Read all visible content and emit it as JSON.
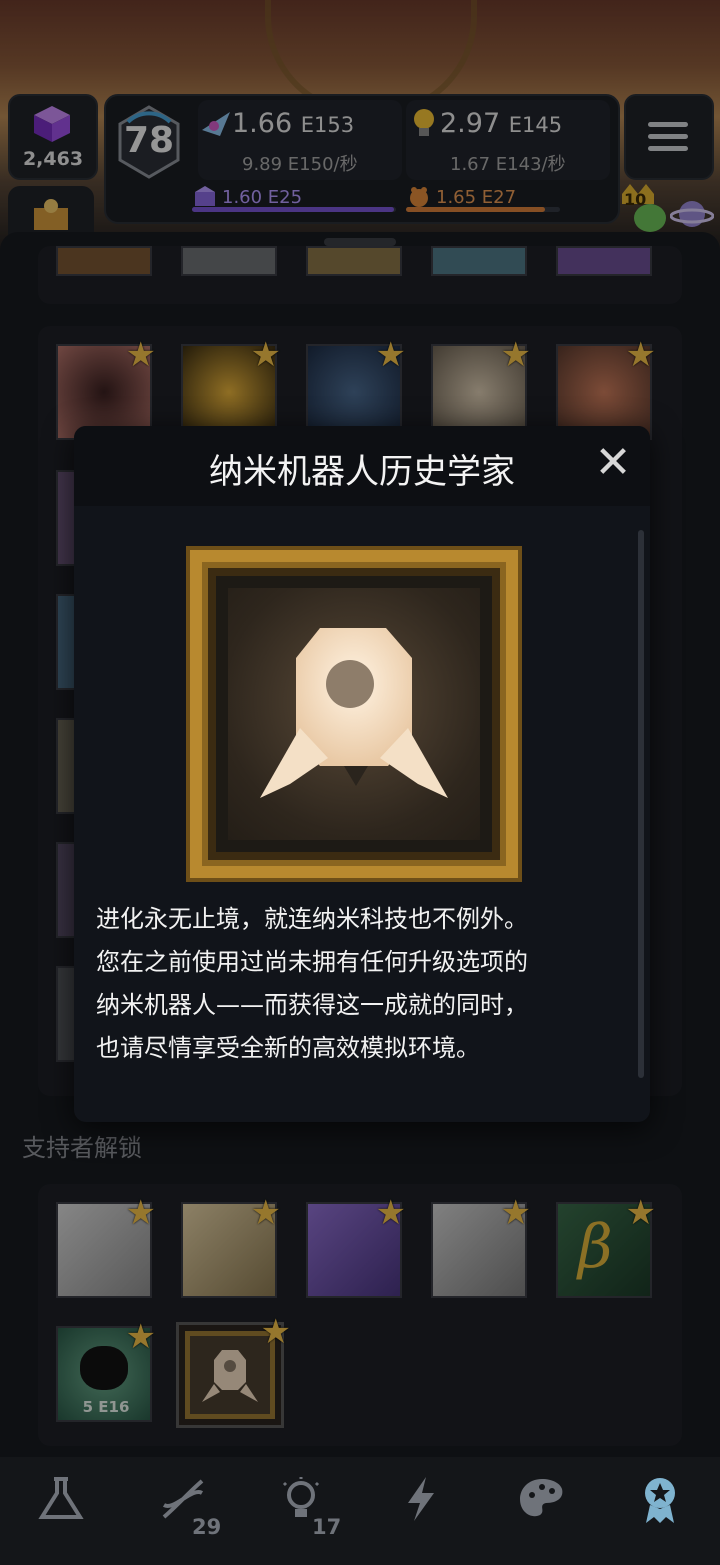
{
  "hud": {
    "cubes": "2,463",
    "level": "78",
    "resource1": {
      "mantissa": "1.66",
      "exp": "E153",
      "rate": "9.89 E150/秒",
      "bar_value": "1.60 E25",
      "bar_progress": 0.99
    },
    "resource2": {
      "mantissa": "2.97",
      "exp": "E145",
      "rate": "1.67 E143/秒",
      "bar_value": "1.65 E27",
      "bar_progress": 0.9
    },
    "badge_count": "10"
  },
  "dialog": {
    "title": "纳米机器人历史学家",
    "close": "✕",
    "description_lines": [
      "进化永无止境，就连纳米科技也不例外。",
      "您在之前使用过尚未拥有任何升级选项的",
      "纳米机器人——而获得这一成就的同时，",
      "也请尽情享受全新的高效模拟环境。"
    ]
  },
  "section": {
    "title": "支持者解锁"
  },
  "support_tiles": [
    {
      "name": "toast-1",
      "label": ""
    },
    {
      "name": "toast-2",
      "label": ""
    },
    {
      "name": "toast-3",
      "label": ""
    },
    {
      "name": "hand",
      "label": ""
    },
    {
      "name": "beta",
      "label": "β"
    },
    {
      "name": "blob",
      "label": "5 E16"
    },
    {
      "name": "nanobot-portrait",
      "label": ""
    }
  ],
  "nav": {
    "items": [
      {
        "name": "lab-tab",
        "badge": ""
      },
      {
        "name": "dna-tab",
        "badge": "29"
      },
      {
        "name": "ideas-tab",
        "badge": "17"
      },
      {
        "name": "energy-tab",
        "badge": ""
      },
      {
        "name": "palette-tab",
        "badge": ""
      },
      {
        "name": "achievements-tab",
        "badge": ""
      }
    ]
  }
}
